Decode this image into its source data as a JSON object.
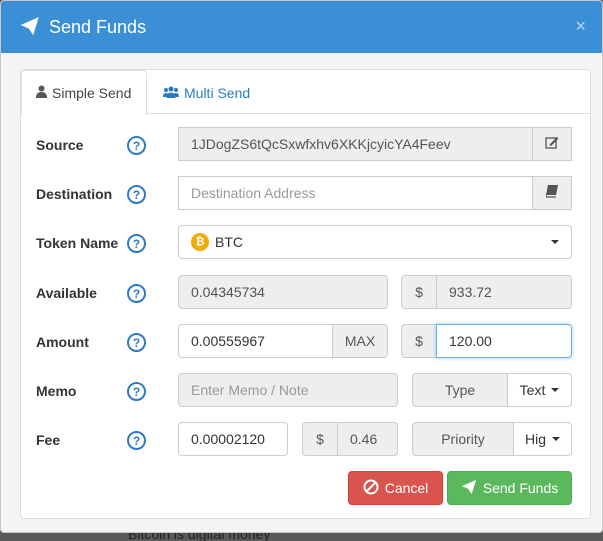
{
  "modal": {
    "title": "Send Funds",
    "close": "×"
  },
  "tabs": [
    {
      "label": "Simple Send",
      "active": true
    },
    {
      "label": "Multi Send",
      "active": false
    }
  ],
  "form": {
    "source": {
      "label": "Source",
      "value": "1JDogZS6tQcSxwfxhv6XKKjcyicYA4Feev"
    },
    "destination": {
      "label": "Destination",
      "placeholder": "Destination Address"
    },
    "token": {
      "label": "Token Name",
      "value": "BTC"
    },
    "available": {
      "label": "Available",
      "amount": "0.04345734",
      "currency": "$",
      "usd": "933.72"
    },
    "amount": {
      "label": "Amount",
      "value": "0.00555967",
      "max": "MAX",
      "currency": "$",
      "usd": "120.00"
    },
    "memo": {
      "label": "Memo",
      "placeholder": "Enter Memo / Note",
      "type_label": "Type",
      "type_value": "Text"
    },
    "fee": {
      "label": "Fee",
      "value": "0.00002120",
      "currency": "$",
      "usd": "0.46",
      "priority_label": "Priority",
      "priority_value": "Hig"
    },
    "help": "?"
  },
  "buttons": {
    "cancel": "Cancel",
    "send": "Send Funds"
  },
  "backdrop": {
    "text": "Bitcoin is digital money"
  },
  "colors": {
    "header": "#3a8fd6",
    "cancel": "#d9534f",
    "send": "#5cb85c",
    "link": "#2a7ac0"
  }
}
